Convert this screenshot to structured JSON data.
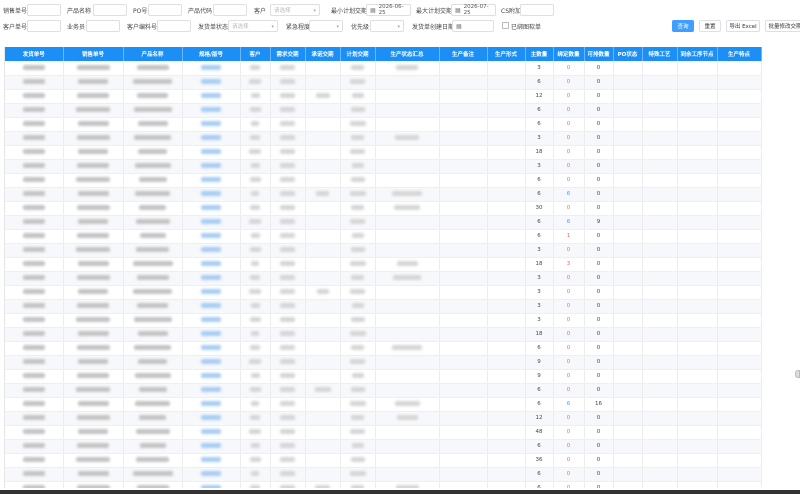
{
  "filters": {
    "row1": [
      {
        "label": "销售单号"
      },
      {
        "label": "产品名称"
      },
      {
        "label": "PO号"
      },
      {
        "label": "产品代码"
      },
      {
        "label": "客户",
        "placeholder": "请选择"
      },
      {
        "label": "最小计划交期",
        "value": "2026-06-25"
      },
      {
        "label": "最大计划交期",
        "value": "2026-07-25"
      },
      {
        "label": "CS附加"
      }
    ],
    "row2": [
      {
        "label": "客户单号"
      },
      {
        "label": "业务员"
      },
      {
        "label": "客户编料号"
      },
      {
        "label": "发货单状态",
        "placeholder": "请选择"
      },
      {
        "label": "紧急程度"
      },
      {
        "label": "优先级"
      },
      {
        "label": "发货单创建日期"
      },
      {
        "label": "已绑图软单"
      }
    ],
    "buttons": {
      "query": "查询",
      "reset": "重置",
      "export": "导出 Excel",
      "batch": "批量修改交期"
    }
  },
  "table": {
    "columns": [
      "发货单号",
      "销售单号",
      "产品名称",
      "规格/版号",
      "客户",
      "需求交期",
      "承诺交期",
      "计划交期",
      "生产状态汇总",
      "生产备注",
      "生产形式",
      "主数量",
      "绑定数量",
      "可排数量",
      "PO状态",
      "特殊工艺",
      "到余工序节点",
      "生产特点"
    ],
    "rows": [
      {
        "main": "3",
        "bound": "0",
        "avail": "0",
        "bound_color": "red"
      },
      {
        "main": "6",
        "bound": "0",
        "avail": "0",
        "bound_color": "red"
      },
      {
        "main": "12",
        "bound": "0",
        "avail": "0",
        "bound_color": "red"
      },
      {
        "main": "6",
        "bound": "0",
        "avail": "0",
        "bound_color": "red"
      },
      {
        "main": "6",
        "bound": "0",
        "avail": "0",
        "bound_color": "red"
      },
      {
        "main": "3",
        "bound": "0",
        "avail": "0",
        "bound_color": "red"
      },
      {
        "main": "18",
        "bound": "0",
        "avail": "0",
        "bound_color": "red"
      },
      {
        "main": "3",
        "bound": "0",
        "avail": "0",
        "bound_color": "red"
      },
      {
        "main": "6",
        "bound": "0",
        "avail": "0",
        "bound_color": "red"
      },
      {
        "main": "6",
        "bound": "6",
        "avail": "0",
        "bound_color": "blue"
      },
      {
        "main": "30",
        "bound": "0",
        "avail": "0",
        "bound_color": "red"
      },
      {
        "main": "6",
        "bound": "6",
        "avail": "9",
        "bound_color": "blue"
      },
      {
        "main": "6",
        "bound": "1",
        "avail": "0",
        "bound_color": "red"
      },
      {
        "main": "3",
        "bound": "0",
        "avail": "0",
        "bound_color": "red"
      },
      {
        "main": "18",
        "bound": "3",
        "avail": "0",
        "bound_color": "red"
      },
      {
        "main": "3",
        "bound": "0",
        "avail": "0",
        "bound_color": "red"
      },
      {
        "main": "3",
        "bound": "0",
        "avail": "0",
        "bound_color": "red"
      },
      {
        "main": "3",
        "bound": "0",
        "avail": "0",
        "bound_color": "red"
      },
      {
        "main": "3",
        "bound": "0",
        "avail": "0",
        "bound_color": "red"
      },
      {
        "main": "18",
        "bound": "0",
        "avail": "0",
        "bound_color": "red"
      },
      {
        "main": "6",
        "bound": "0",
        "avail": "0",
        "bound_color": "red"
      },
      {
        "main": "9",
        "bound": "0",
        "avail": "0",
        "bound_color": "red"
      },
      {
        "main": "9",
        "bound": "0",
        "avail": "0",
        "bound_color": "red"
      },
      {
        "main": "6",
        "bound": "0",
        "avail": "0",
        "bound_color": "red"
      },
      {
        "main": "6",
        "bound": "6",
        "avail": "16",
        "bound_color": "blue"
      },
      {
        "main": "12",
        "bound": "0",
        "avail": "0",
        "bound_color": "red"
      },
      {
        "main": "48",
        "bound": "0",
        "avail": "0",
        "bound_color": "red"
      },
      {
        "main": "6",
        "bound": "0",
        "avail": "0",
        "bound_color": "red"
      },
      {
        "main": "36",
        "bound": "0",
        "avail": "0",
        "bound_color": "red"
      },
      {
        "main": "6",
        "bound": "0",
        "avail": "0",
        "bound_color": "red"
      },
      {
        "main": "6",
        "bound": "0",
        "avail": "0",
        "bound_color": "red"
      }
    ]
  },
  "colors": {
    "header": "#1b8ff5",
    "primary": "#409eff",
    "danger": "#f56c6c"
  }
}
